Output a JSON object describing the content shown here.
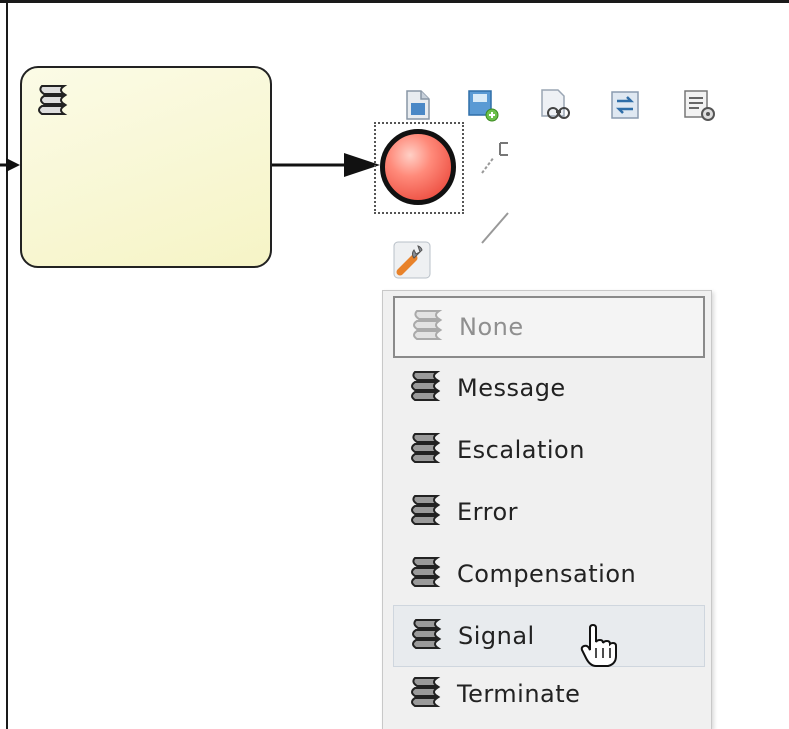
{
  "canvas": {
    "end_event": {
      "type": "end",
      "selected": true
    },
    "task": {
      "type": "task"
    }
  },
  "toolbar": {
    "icons": [
      "document-icon",
      "add-node-icon",
      "search-binoculars-icon",
      "convert-icon",
      "properties-icon",
      "annotation-icon",
      "connector-icon",
      "morph-wrench-icon"
    ]
  },
  "end_type_menu": {
    "selected_label": "None",
    "hovered_label": "Signal",
    "items": [
      {
        "label": "None"
      },
      {
        "label": "Message"
      },
      {
        "label": "Escalation"
      },
      {
        "label": "Error"
      },
      {
        "label": "Compensation"
      },
      {
        "label": "Signal"
      },
      {
        "label": "Terminate"
      }
    ]
  },
  "colors": {
    "end_event_fill": "#e5372b",
    "task_fill": "#f6f4c6",
    "menu_bg": "#f0f0f0"
  }
}
